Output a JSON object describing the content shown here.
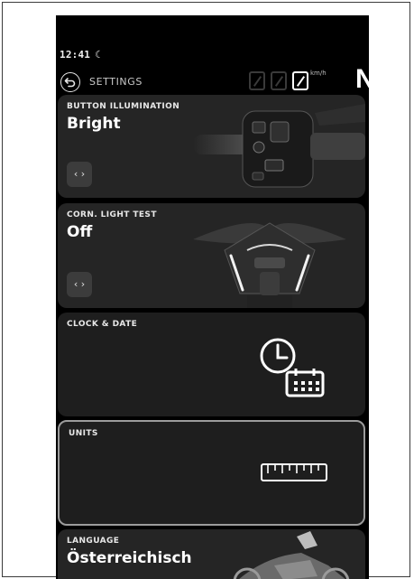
{
  "status": {
    "time": "12:41",
    "moon_icon": "moon-icon"
  },
  "header": {
    "title": "SETTINGS",
    "speed_unit": "km/h",
    "speed_value": "0",
    "gear": "N"
  },
  "cards": [
    {
      "label": "BUTTON ILLUMINATION",
      "value": "Bright",
      "arrows": "‹ ›"
    },
    {
      "label": "CORN. LIGHT TEST",
      "value": "Off",
      "arrows": "‹ ›"
    },
    {
      "label": "CLOCK & DATE"
    },
    {
      "label": "UNITS"
    },
    {
      "label": "LANGUAGE",
      "value": "Österreichisch"
    }
  ]
}
